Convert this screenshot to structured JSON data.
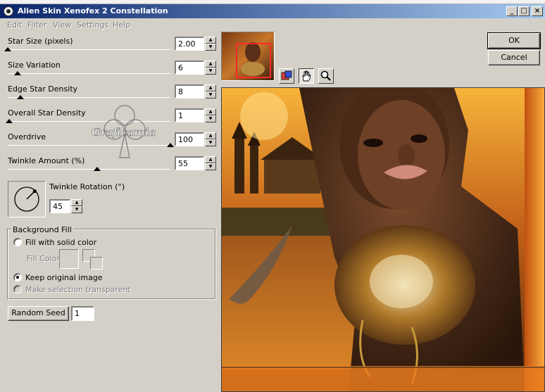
{
  "window": {
    "title": "Alien Skin Xenofex 2 Constellation"
  },
  "menu": [
    "Edit",
    "Filter",
    "View",
    "Settings",
    "Help"
  ],
  "params": [
    {
      "label": "Star Size (pixels)",
      "value": "2.00",
      "level": 0.0
    },
    {
      "label": "Size Variation",
      "value": "6",
      "level": 0.06
    },
    {
      "label": "Edge Star Density",
      "value": "8",
      "level": 0.08
    },
    {
      "label": "Overall Star Density",
      "value": "1",
      "level": 0.01
    },
    {
      "label": "Overdrive",
      "value": "100",
      "level": 1.0
    },
    {
      "label": "Twinkle Amount (%)",
      "value": "55",
      "level": 0.55
    }
  ],
  "twinkle_rotation": {
    "label": "Twinkle Rotation (°)",
    "value": "45"
  },
  "background_fill": {
    "title": "Background Fill",
    "option_solid": "Fill with solid color",
    "fill_color_label": "Fill Color",
    "option_keep": "Keep original image",
    "option_transparent": "Make selection transparent",
    "selected": "keep"
  },
  "random_seed": {
    "label": "Random Seed",
    "value": "1"
  },
  "buttons": {
    "ok": "OK",
    "cancel": "Cancel"
  },
  "watermark": "Graficamia",
  "icons": {
    "tools": [
      "preview-zoom-icon",
      "hand-pan-icon",
      "magnifier-icon"
    ]
  },
  "colors": {
    "titlebar_start": "#0a246a",
    "titlebar_end": "#a6caf0",
    "dialog_bg": "#d4d0c8"
  }
}
